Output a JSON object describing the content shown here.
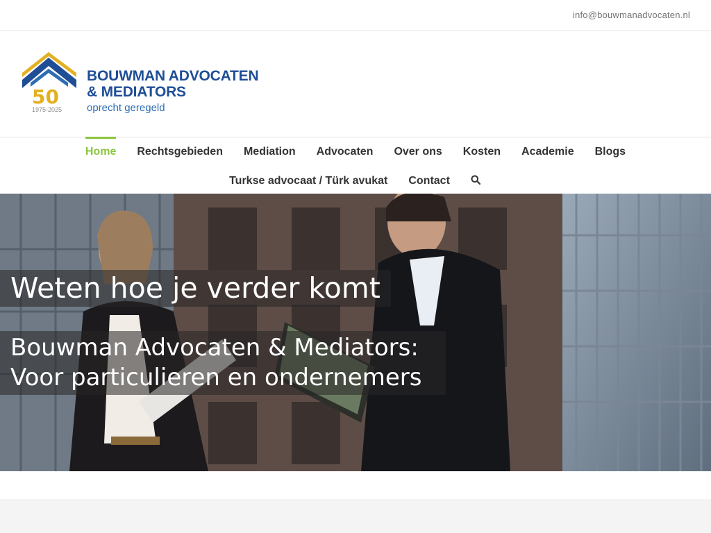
{
  "topbar": {
    "email": "info@bouwmanadvocaten.nl"
  },
  "logo": {
    "brand_line1": "BOUWMAN ADVOCATEN",
    "brand_line2": "& MEDIATORS",
    "tagline": "oprecht geregeld",
    "anniversary": "50",
    "years": "1975-2025"
  },
  "nav": {
    "row1": [
      {
        "label": "Home",
        "active": true
      },
      {
        "label": "Rechtsgebieden"
      },
      {
        "label": "Mediation"
      },
      {
        "label": "Advocaten"
      },
      {
        "label": "Over ons"
      },
      {
        "label": "Kosten"
      },
      {
        "label": "Academie"
      },
      {
        "label": "Blogs"
      }
    ],
    "row2": [
      {
        "label": "Turkse advocaat / Türk avukat"
      },
      {
        "label": "Contact"
      }
    ],
    "search_icon": "search-icon"
  },
  "hero": {
    "headline": "Weten hoe je verder komt",
    "sub_line1": "Bouwman Advocaten & Mediators:",
    "sub_line2": "Voor particulieren en ondernemers"
  },
  "colors": {
    "accent": "#8cc63f",
    "brand_blue": "#1f4e96",
    "logo_gold": "#e3b021"
  }
}
